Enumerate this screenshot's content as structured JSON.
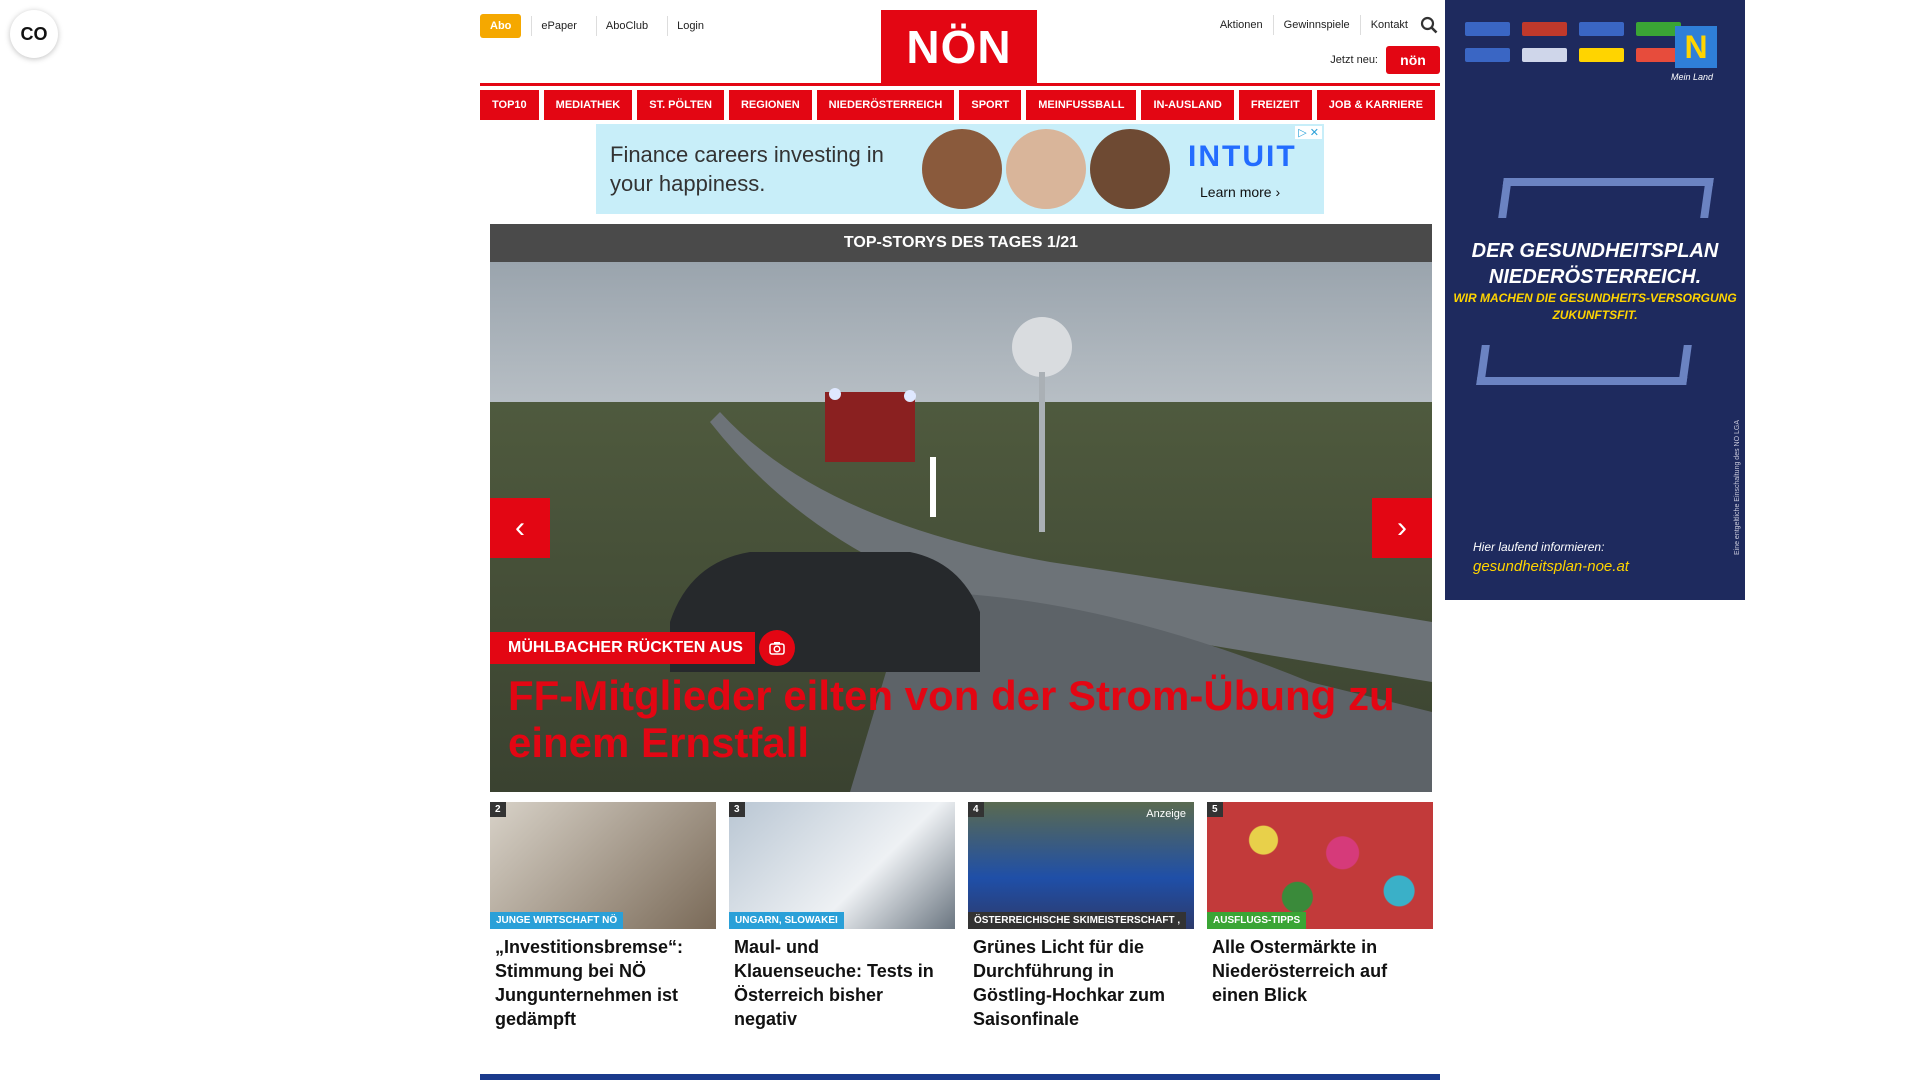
{
  "header": {
    "abo": "Abo",
    "links": [
      "ePaper",
      "AboClub",
      "Login"
    ],
    "logo": "NÖN",
    "right_links": [
      "Aktionen",
      "Gewinnspiele",
      "Kontakt"
    ],
    "jetzt_label": "Jetzt neu:",
    "jetzt_badge": "nön",
    "accessibility": "CO"
  },
  "nav": [
    "TOP10",
    "MEDIATHEK",
    "ST. PÖLTEN",
    "REGIONEN",
    "NIEDERÖSTERREICH",
    "SPORT",
    "MEINFUSSBALL",
    "IN-AUSLAND",
    "FREIZEIT",
    "JOB & KARRIERE"
  ],
  "ad_banner": {
    "text": "Finance careers investing in your happiness.",
    "brand": "INTUIT",
    "cta": "Learn more ›"
  },
  "sky_ad": {
    "headline": "DER GESUNDHEITSPLAN NIEDERÖSTERREICH.",
    "sub": "WIR MACHEN DIE GESUNDHEITS-VERSORGUNG ZUKUNFTSFIT.",
    "info": "Hier laufend informieren:",
    "url": "gesundheitsplan-noe.at",
    "mein_land": "Mein Land",
    "side_note": "Eine entgeltliche Einschaltung des NÖ LGA"
  },
  "slider": {
    "header": "TOP-STORYS DES TAGES 1/21",
    "kicker": "MÜHLBACHER RÜCKTEN AUS",
    "headline": "FF-Mitglieder eilten von der Strom-Übung zu einem Ernstfall",
    "prev": "‹",
    "next": "›"
  },
  "teasers": [
    {
      "num": "2",
      "category": "JUNGE WIRTSCHAFT NÖ",
      "cat_color": "#2aa0d8",
      "title": "„Investitionsbremse“: Stimmung bei NÖ Jungunternehmen ist gedämpft",
      "anzeige": ""
    },
    {
      "num": "3",
      "category": "UNGARN, SLOWAKEI",
      "cat_color": "#2aa0d8",
      "title": "Maul- und Klauenseuche: Tests in Österreich bisher negativ",
      "anzeige": ""
    },
    {
      "num": "4",
      "category": "ÖSTERREICHISCHE SKIMEISTERSCHAFT ,",
      "cat_color": "#333333",
      "title": "Grünes Licht für die Durchführung in Göstling-Hochkar zum Saisonfinale",
      "anzeige": "Anzeige"
    },
    {
      "num": "5",
      "category": "AUSFLUGS-TIPPS",
      "cat_color": "#3aa535",
      "title": "Alle Ostermärkte in Niederösterreich auf einen Blick",
      "anzeige": ""
    }
  ]
}
